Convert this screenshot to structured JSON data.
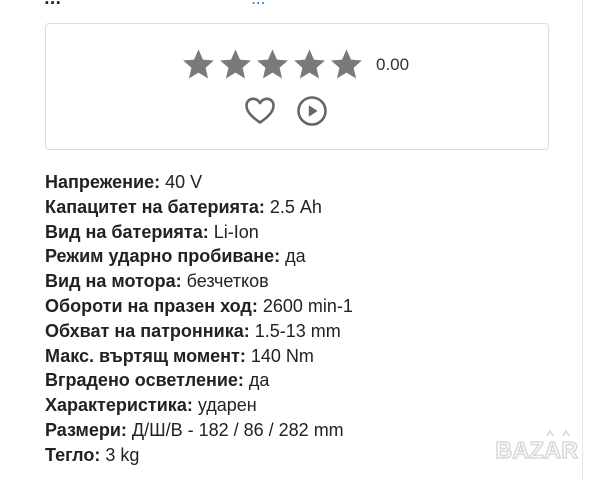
{
  "header_partial": {
    "left_text": "...",
    "right_text": "..."
  },
  "rating": {
    "stars_total": 5,
    "value": "0.00",
    "star_color": "#7a7a7a"
  },
  "actions": {
    "favorite_icon": "heart-icon",
    "play_icon": "play-circle-icon",
    "icon_color": "#666666"
  },
  "specs": [
    {
      "label": "Напрежение:",
      "value": "40 V"
    },
    {
      "label": "Капацитет на батерията:",
      "value": "2.5 Ah"
    },
    {
      "label": "Вид на батерията:",
      "value": "Li-Ion"
    },
    {
      "label": "Режим ударно пробиване:",
      "value": "да"
    },
    {
      "label": "Вид на мотора:",
      "value": "безчетков"
    },
    {
      "label": "Обороти на празен ход:",
      "value": "2600 min-1"
    },
    {
      "label": "Обхват на патронника:",
      "value": "1.5-13 mm"
    },
    {
      "label": "Макс. въртящ момент:",
      "value": "140 Nm"
    },
    {
      "label": "Вградено осветление:",
      "value": "да"
    },
    {
      "label": "Характеристика:",
      "value": "ударен"
    },
    {
      "label": "Размери:",
      "value": "Д/Ш/В - 182 / 86 / 282 mm"
    },
    {
      "label": "Тегло:",
      "value": "3 kg"
    }
  ],
  "watermark": {
    "text": "BAZAR",
    "color": "#d9d9d9"
  }
}
